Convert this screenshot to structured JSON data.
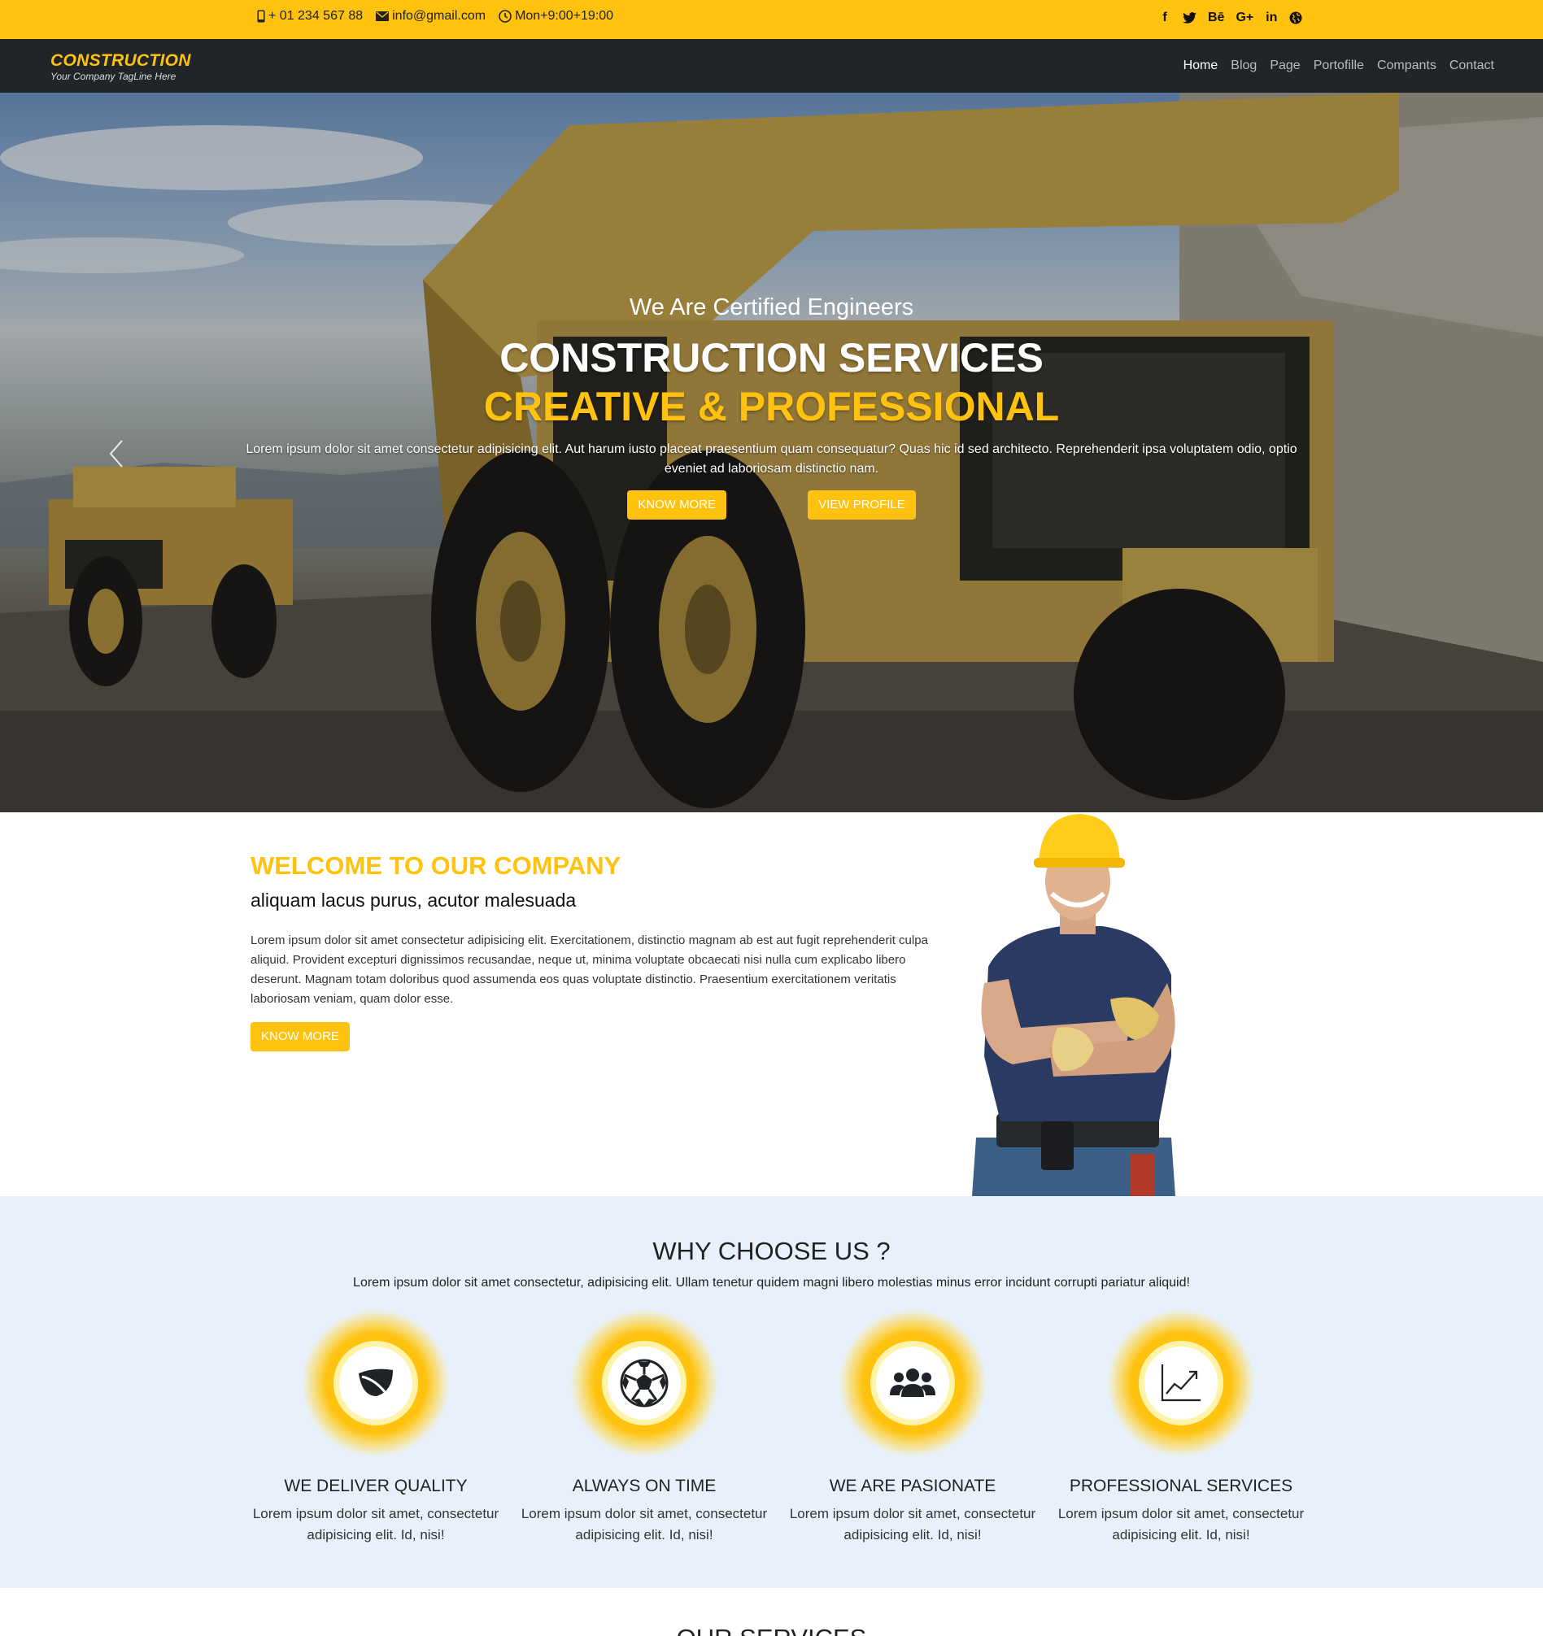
{
  "topbar": {
    "phone": "+ 01 234 567 88",
    "email": "info@gmail.com",
    "hours": "Mon+9:00+19:00",
    "social": [
      {
        "label": "f",
        "icon": "facebook-icon"
      },
      {
        "label": "🐦",
        "icon": "twitter-icon"
      },
      {
        "label": "Bē",
        "icon": "behance-icon"
      },
      {
        "label": "G+",
        "icon": "google-plus-icon"
      },
      {
        "label": "in",
        "icon": "linkedin-icon"
      },
      {
        "label": "🌐",
        "icon": "globe-icon"
      }
    ]
  },
  "brand": {
    "logo": "CONSTRUCTION",
    "tagline": "Your Company TagLine Here"
  },
  "nav": {
    "items": [
      "Home",
      "Blog",
      "Page",
      "Portofille",
      "Compants",
      "Contact"
    ],
    "active": "Home"
  },
  "hero": {
    "subtitle": "We Are Certified Engineers",
    "title": "CONSTRUCTION SERVICES",
    "title_highlight": "CREATIVE & PROFESSIONAL",
    "text": "Lorem ipsum dolor sit amet consectetur adipisicing elit. Aut harum iusto placeat praesentium quam consequatur? Quas hic id sed architecto. Reprehenderit ipsa voluptatem odio, optio eveniet ad laboriosam distinctio nam.",
    "button_primary": "KNOW MORE",
    "button_secondary": "VIEW PROFILE"
  },
  "welcome": {
    "title": "WELCOME TO OUR COMPANY",
    "subtitle": "aliquam lacus purus, acutor malesuada",
    "text": "Lorem ipsum dolor sit amet consectetur adipisicing elit. Exercitationem, distinctio magnam ab est aut fugit reprehenderit culpa aliquid. Provident excepturi dignissimos recusandae, neque ut, minima voluptate obcaecati nisi nulla cum explicabo libero deserunt. Magnam totam doloribus quod assumenda eos quas voluptate distinctio. Praesentium exercitationem veritatis laboriosam veniam, quam dolor esse.",
    "button": "KNOW MORE"
  },
  "why": {
    "title": "WHY CHOOSE US ?",
    "text": "Lorem ipsum dolor sit amet consectetur, adipisicing elit. Ullam tenetur quidem magni libero molestias minus error incidunt corrupti pariatur aliquid!",
    "cards": [
      {
        "title": "WE DELIVER QUALITY",
        "line1": "Lorem ipsum dolor sit amet, consectetur",
        "line2": "adipisicing elit. Id, nisi!",
        "icon": "leaf-icon"
      },
      {
        "title": "ALWAYS ON TIME",
        "line1": "Lorem ipsum dolor sit amet, consectetur",
        "line2": "adipisicing elit. Id, nisi!",
        "icon": "soccer-ball-icon"
      },
      {
        "title": "WE ARE PASIONATE",
        "line1": "Lorem ipsum dolor sit amet, consectetur",
        "line2": "adipisicing elit. Id, nisi!",
        "icon": "users-icon"
      },
      {
        "title": "PROFESSIONAL SERVICES",
        "line1": "Lorem ipsum dolor sit amet, consectetur",
        "line2": "adipisicing elit. Id, nisi!",
        "icon": "chart-line-icon"
      }
    ]
  },
  "services": {
    "title": "OUR SERVICES"
  },
  "colors": {
    "accent": "#ffc20e",
    "navbar": "#212529",
    "why_bg": "#e8f1fb"
  }
}
